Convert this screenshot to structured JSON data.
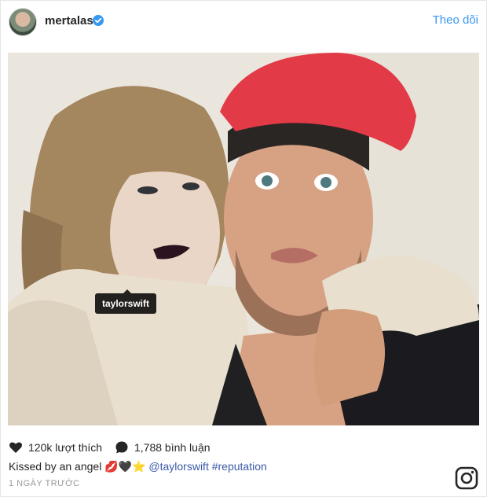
{
  "header": {
    "username": "mertalas",
    "follow_label": "Theo dõi"
  },
  "photo": {
    "tag_label": "taylorswift"
  },
  "actions": {
    "likes_text": "120k lượt thích",
    "comments_text": "1,788 bình luận"
  },
  "caption": {
    "text": "Kissed by an angel",
    "emojis": "💋🖤⭐",
    "mention": "@taylorswift",
    "hashtag": "#reputation"
  },
  "meta": {
    "time": "1 NGÀY TRƯỚC"
  },
  "colors": {
    "accent": "#3897f0",
    "link": "#3a5aa8"
  },
  "icons": [
    "verified-badge-icon",
    "heart-icon",
    "comment-icon",
    "user-tag-icon",
    "instagram-logo-icon"
  ]
}
